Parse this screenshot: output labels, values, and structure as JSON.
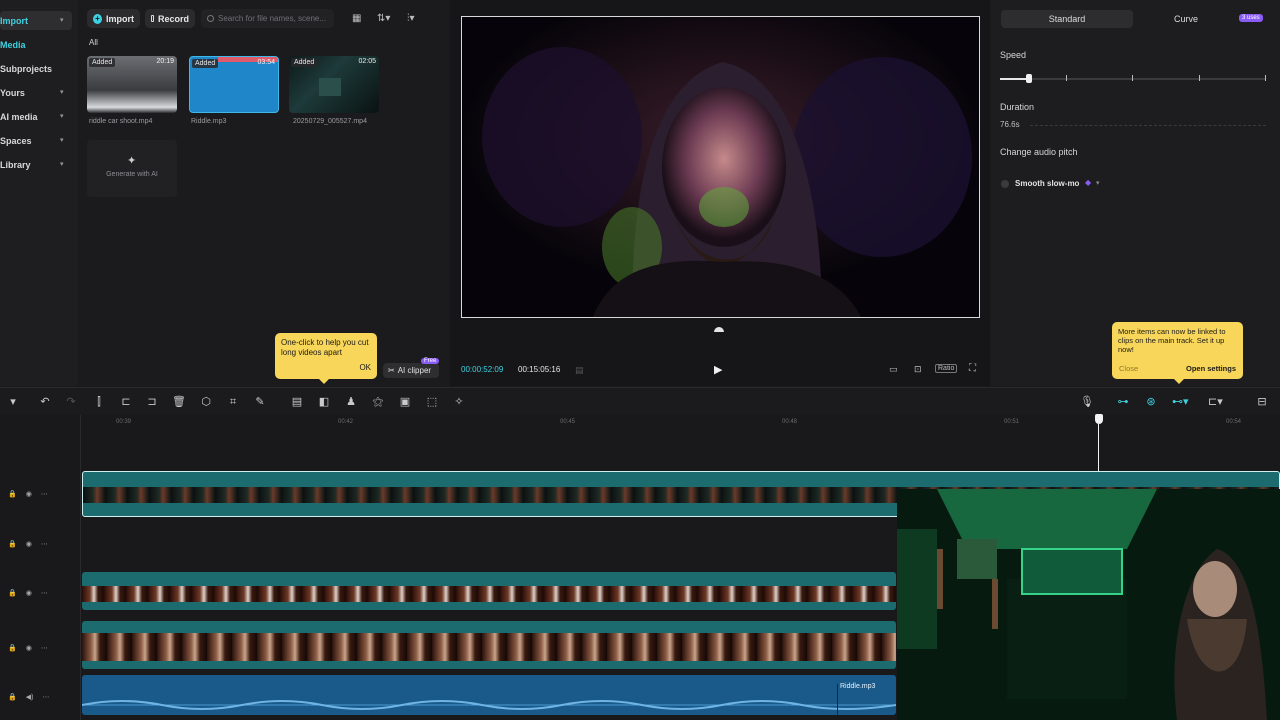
{
  "leftnav": {
    "items": [
      {
        "label": "Import",
        "active": true
      },
      {
        "label": "Media",
        "active": false
      },
      {
        "label": "Subprojects",
        "active": false
      },
      {
        "label": "Yours",
        "active": false
      },
      {
        "label": "AI media",
        "active": false
      },
      {
        "label": "Spaces",
        "active": false
      },
      {
        "label": "Library",
        "active": false
      }
    ]
  },
  "media": {
    "import_label": "Import",
    "record_label": "Record",
    "search_placeholder": "Search for file names, scene...",
    "filter_label": "All",
    "items": [
      {
        "badge": "Added",
        "duration": "20:19",
        "name": "riddle car shoot.mp4"
      },
      {
        "badge": "Added",
        "duration": "03:54",
        "name": "Riddle.mp3"
      },
      {
        "badge": "Added",
        "duration": "02:05",
        "name": "20250729_005527.mp4"
      }
    ],
    "generate_label": "Generate with AI"
  },
  "tooltip_left": {
    "text": "One-click to help you cut long videos apart",
    "ok_label": "OK"
  },
  "ai_clipper": {
    "label": "AI clipper",
    "badge": "Free"
  },
  "player": {
    "current_time": "00:00:52:09",
    "total_time": "00:15:05:16",
    "ratio_label": "Ratio"
  },
  "rightpanel": {
    "tab_standard": "Standard",
    "tab_curve": "Curve",
    "uses_badge": "3 uses",
    "speed_label": "Speed",
    "speed_fraction": 0.11,
    "duration_label": "Duration",
    "duration_value": "76.6s",
    "pitch_label": "Change audio pitch",
    "slowmo_label": "Smooth slow-mo"
  },
  "tooltip_right": {
    "text": "More items can now be linked to clips on the main track. Set it up now!",
    "close_label": "Close",
    "settings_label": "Open settings"
  },
  "timeline": {
    "ruler": [
      "00:39",
      "00:42",
      "00:45",
      "00:48",
      "00:51",
      "00:54"
    ],
    "audio_clip_name": "Riddle.mp3"
  },
  "colors": {
    "accent": "#3fd1e0",
    "tooltip": "#f8d65a",
    "video_track": "#1b6b6f",
    "audio_track": "#1a5a8a",
    "badge_purple": "#8a5cf6"
  }
}
